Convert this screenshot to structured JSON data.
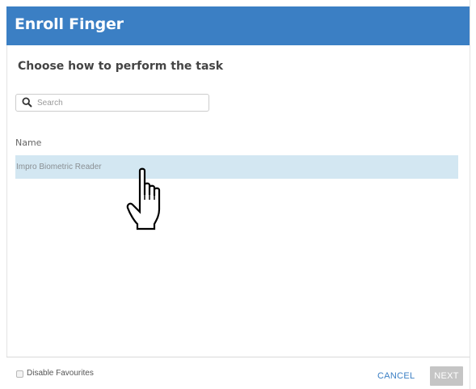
{
  "dialog": {
    "title": "Enroll Finger",
    "subtitle": "Choose how to perform the task",
    "accent_color": "#3b7fc4"
  },
  "search": {
    "placeholder": "Search",
    "value": "",
    "icon": "search-icon"
  },
  "list": {
    "column_header": "Name",
    "items": [
      {
        "label": "Impro Biometric Reader",
        "selected": true
      }
    ],
    "selected_row_color": "#d3e7f2"
  },
  "footer": {
    "checkbox_label": "Disable Favourites",
    "checkbox_checked": false,
    "cancel_label": "CANCEL",
    "next_label": "NEXT",
    "next_enabled": false
  },
  "cursor": {
    "icon": "hand-pointer-icon"
  }
}
